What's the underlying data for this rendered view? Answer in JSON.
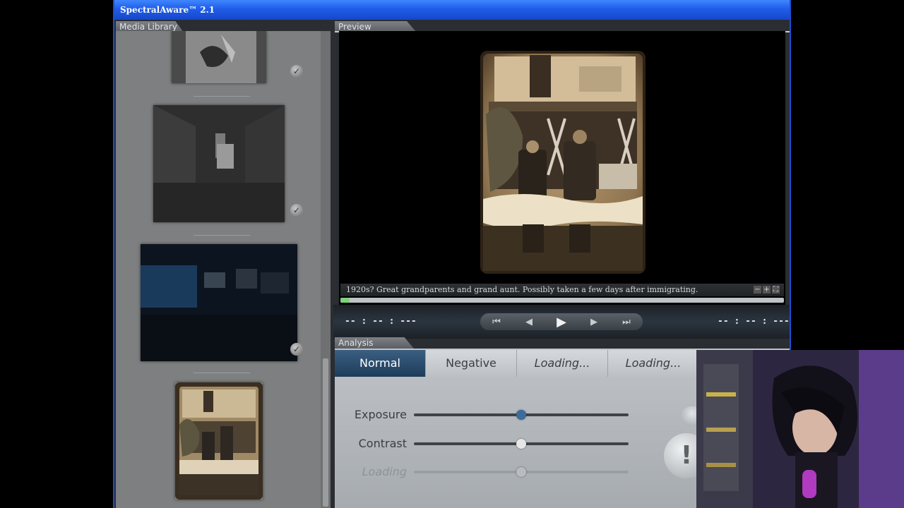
{
  "window": {
    "title": "SpectralAware™ 2.1"
  },
  "media_library": {
    "tab_label": "Media Library",
    "items": [
      {
        "name": "photo-man-hands",
        "checked": true
      },
      {
        "name": "photo-warehouse-handtruck",
        "checked": true
      },
      {
        "name": "photo-dark-blue-room",
        "checked": true
      },
      {
        "name": "photo-family-porch",
        "checked": false
      }
    ]
  },
  "preview": {
    "tab_label": "Preview",
    "caption": "1920s? Great grandparents and grand aunt. Possibly taken a few days after immigrating.",
    "zoom_out": "−",
    "zoom_in": "+",
    "fit": "⛶",
    "time_left": "-- : -- : ---",
    "time_right": "-- : -- : ---",
    "progress_fraction": 0.02,
    "controls": {
      "skip_back": "⏮",
      "step_back": "◀",
      "play": "▶",
      "step_forward": "▶",
      "skip_forward": "⏭"
    }
  },
  "analysis": {
    "tab_label": "Analysis",
    "tabs": [
      "Normal",
      "Negative",
      "Loading...",
      "Loading..."
    ],
    "active_tab": 0,
    "sliders": [
      {
        "label": "Exposure",
        "value": 0.5,
        "enabled": true,
        "knob_color": "#3d6b9a"
      },
      {
        "label": "Contrast",
        "value": 0.5,
        "enabled": true,
        "knob_color": "#e6e6e6"
      },
      {
        "label": "Loading",
        "value": 0.5,
        "enabled": false,
        "knob_color": "#b8bcc0"
      }
    ],
    "alert_button": "!"
  },
  "colors": {
    "titlebar": "#1f5de8",
    "active_tab": "#2a4e72",
    "progress": "#7fd07a"
  }
}
